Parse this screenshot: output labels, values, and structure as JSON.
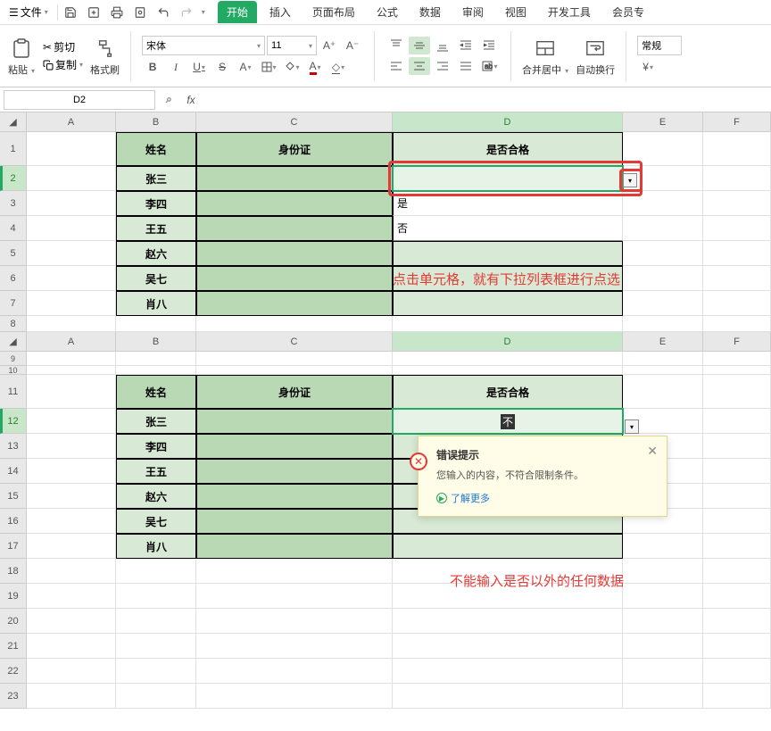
{
  "menu": {
    "file_label": "文件",
    "tabs": [
      "开始",
      "插入",
      "页面布局",
      "公式",
      "数据",
      "审阅",
      "视图",
      "开发工具",
      "会员专"
    ]
  },
  "ribbon": {
    "paste": "粘贴",
    "cut": "剪切",
    "copy": "复制",
    "formatpainter": "格式刷",
    "font_name": "宋体",
    "font_size": "11",
    "merge": "合并居中",
    "wrap": "自动换行",
    "general": "常规"
  },
  "namebox": "D2",
  "columns": [
    "A",
    "B",
    "C",
    "D",
    "E",
    "F"
  ],
  "header_row": {
    "b": "姓名",
    "c": "身份证",
    "d": "是否合格"
  },
  "names": [
    "张三",
    "李四",
    "王五",
    "赵六",
    "吴七",
    "肖八"
  ],
  "dropdown": {
    "opt1": "是",
    "opt2": "否"
  },
  "annot1": "点击单元格，就有下拉列表框进行点选",
  "table2_input": "不",
  "error": {
    "title": "错误提示",
    "msg": "您输入的内容，不符合限制条件。",
    "link": "了解更多"
  },
  "annot2": "不能输入是否以外的任何数据"
}
